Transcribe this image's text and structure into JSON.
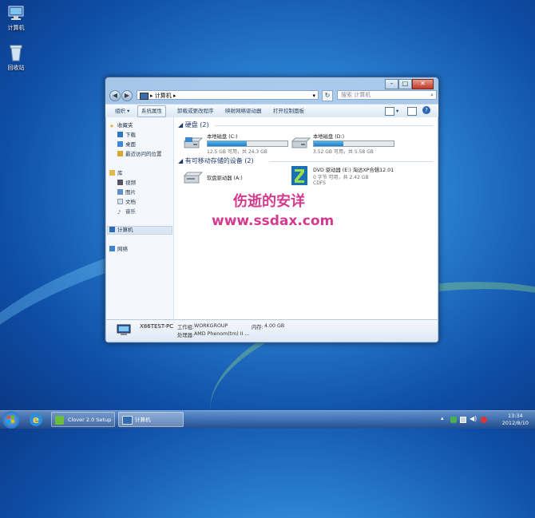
{
  "desktop": {
    "icons": [
      {
        "label": "计算机"
      },
      {
        "label": "回收站"
      }
    ]
  },
  "window": {
    "breadcrumb": "计算机",
    "search_placeholder": "搜索 计算机",
    "toolbar": [
      "组织 ▾",
      "系统属性",
      "卸载或更改程序",
      "映射网络驱动器",
      "打开控制面板"
    ],
    "nav": {
      "favorites": {
        "header": "收藏夹",
        "items": [
          "下载",
          "桌面",
          "最近访问的位置"
        ]
      },
      "libraries": {
        "header": "库",
        "items": [
          "视频",
          "图片",
          "文档",
          "音乐"
        ]
      },
      "computer": "计算机",
      "network": "网络"
    },
    "hard_disks": {
      "header": "硬盘 (2)",
      "drives": [
        {
          "name": "本地磁盘 (C:)",
          "space": "12.5 GB 可用，共 24.3 GB",
          "used_fraction": 0.49
        },
        {
          "name": "本地磁盘 (D:)",
          "space": "3.52 GB 可用，共 5.58 GB",
          "used_fraction": 0.37
        }
      ]
    },
    "removable": {
      "header": "有可移动存储的设备 (2)",
      "floppy": {
        "name": "软盘驱动器 (A:)"
      },
      "dvd": {
        "name": "DVD 驱动器 (E:) 淘达XP合辑12.01",
        "space": "0 字节 可用，共 2.42 GB",
        "fs": "CDFS"
      }
    },
    "watermark": {
      "line1": "伤逝的安详",
      "line2": "www.ssdax.com"
    },
    "details": {
      "pc_name": "X86TEST-PC",
      "workgroup_label": "工作组:",
      "workgroup": "WORKGROUP",
      "memory_label": "内存:",
      "memory": "4.00 GB",
      "cpu_label": "处理器:",
      "cpu": "AMD Phenom(tm) II ..."
    }
  },
  "taskbar": {
    "buttons": [
      "Clover 2.0 Setup",
      "计算机"
    ],
    "clock": {
      "time": "13:34",
      "date": "2012/8/10"
    }
  },
  "colors": {
    "accent": "#1b80c8",
    "watermark": "#d43a8e",
    "desktop": "#1f66c0"
  }
}
